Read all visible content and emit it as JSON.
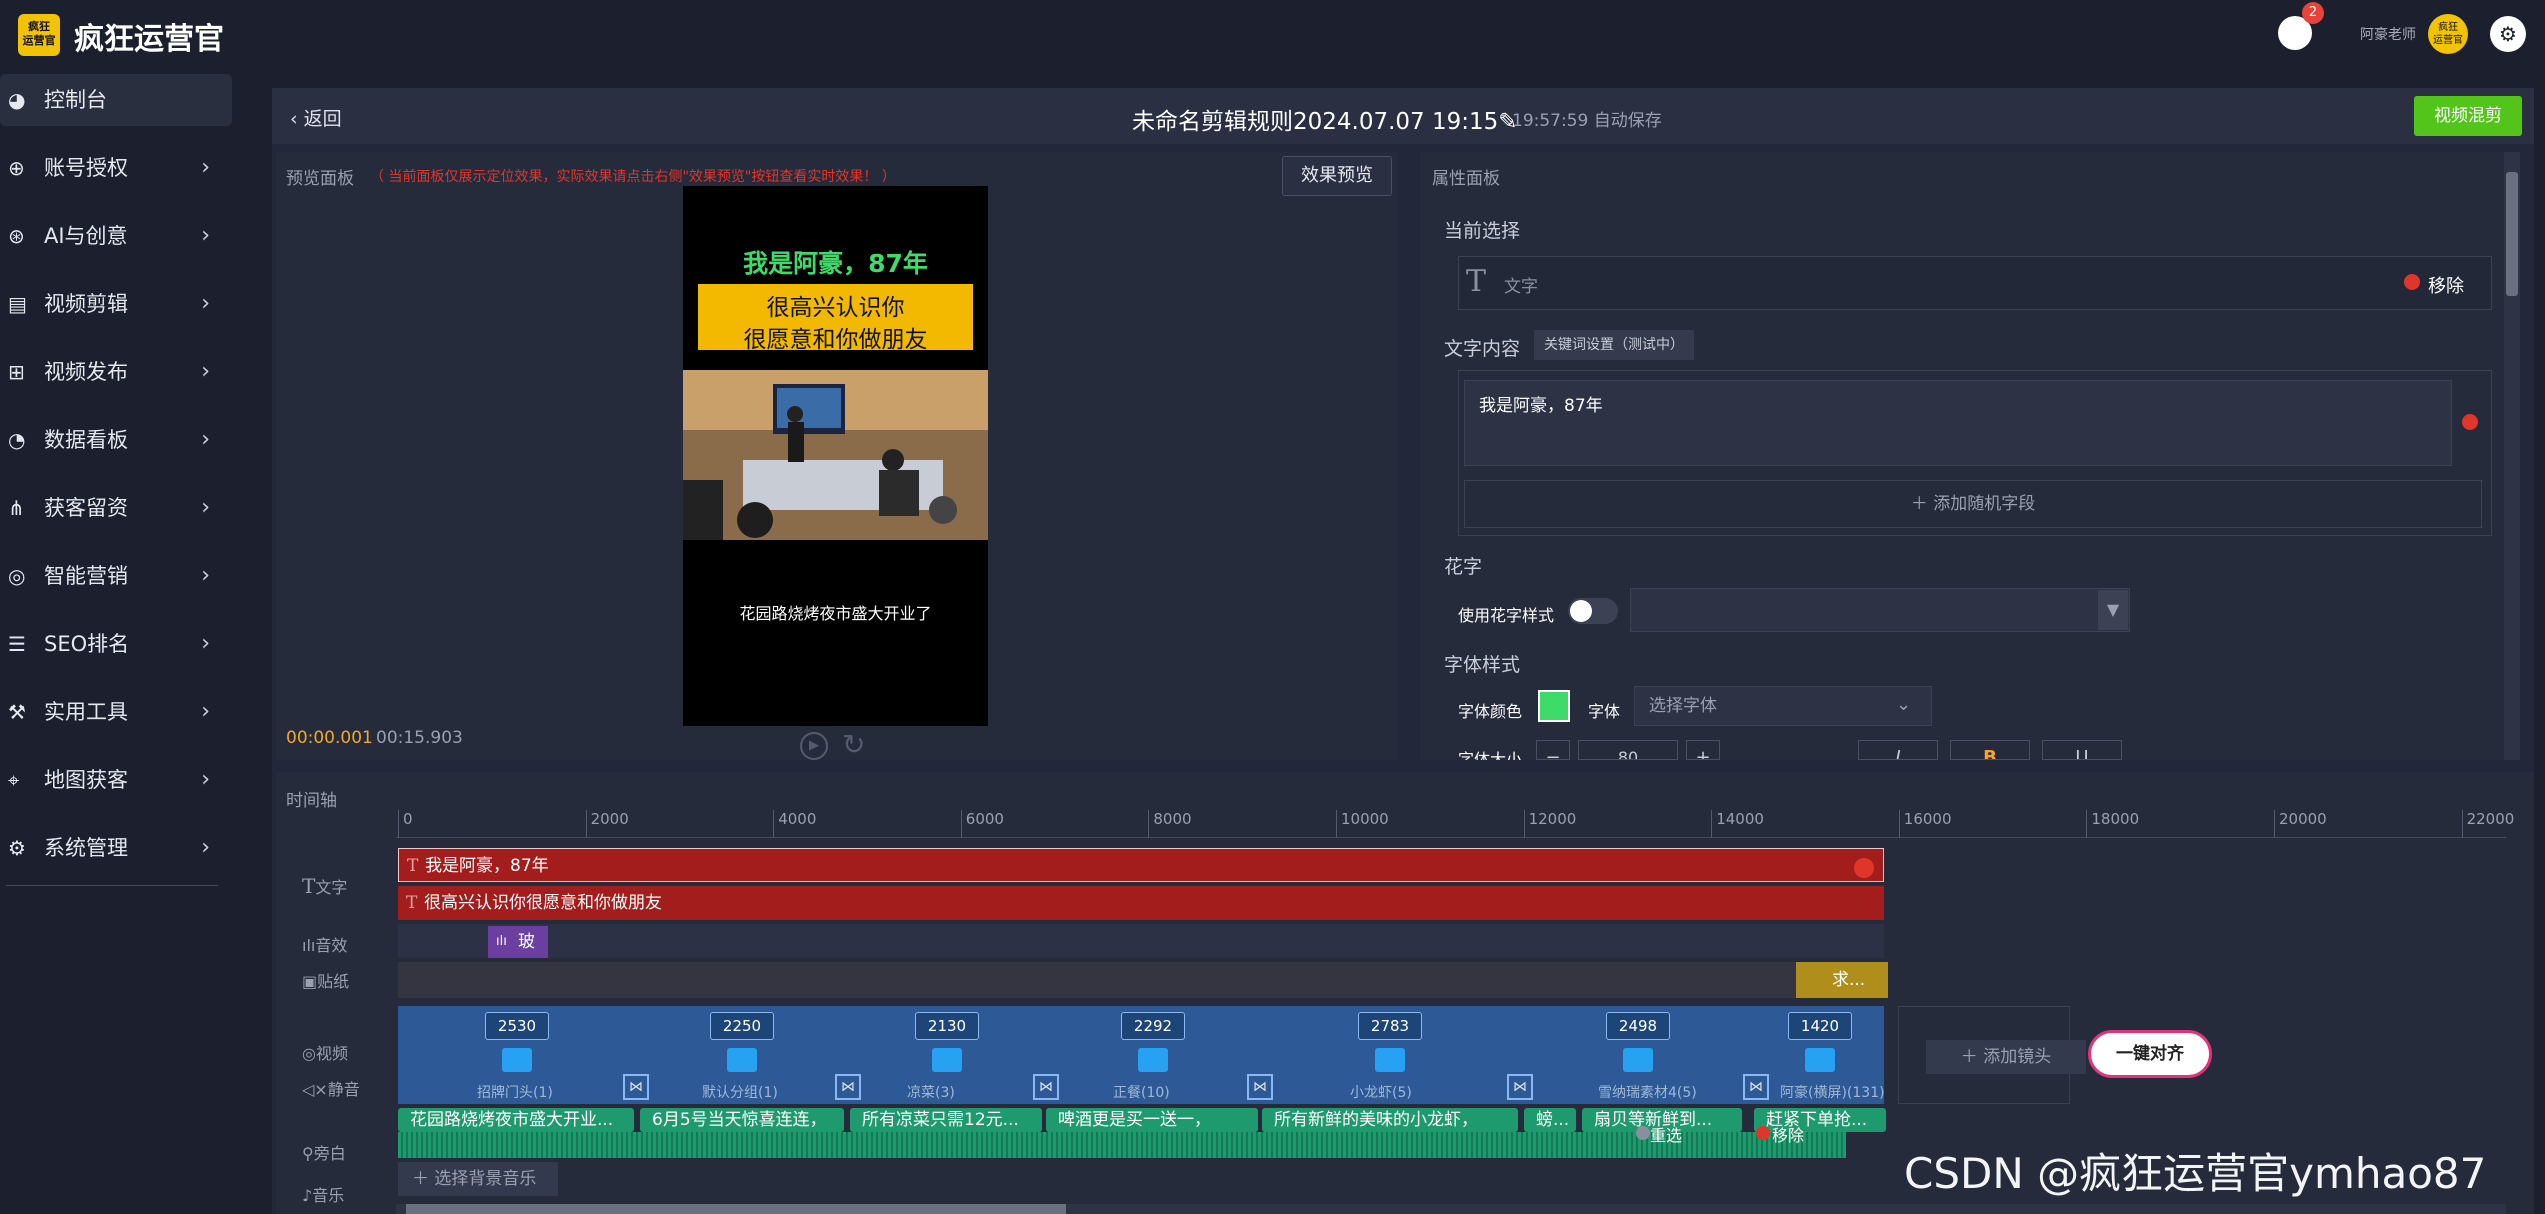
{
  "app": {
    "logo_text": "疯狂\n运营官",
    "brand": "疯狂运营官",
    "notifications": "2",
    "user": "阿豪老师",
    "avatar_text": "疯狂\n运营官"
  },
  "sidebar": {
    "items": [
      {
        "label": "控制台",
        "icon": "dashboard-icon",
        "active": true
      },
      {
        "label": "账号授权",
        "icon": "crosshair-icon"
      },
      {
        "label": "AI与创意",
        "icon": "globe-icon"
      },
      {
        "label": "视频剪辑",
        "icon": "film-icon"
      },
      {
        "label": "视频发布",
        "icon": "grid-icon"
      },
      {
        "label": "数据看板",
        "icon": "pie-icon"
      },
      {
        "label": "获客留资",
        "icon": "org-icon"
      },
      {
        "label": "智能营销",
        "icon": "target-icon"
      },
      {
        "label": "SEO排名",
        "icon": "list-icon"
      },
      {
        "label": "实用工具",
        "icon": "tools-icon"
      },
      {
        "label": "地图获客",
        "icon": "map-icon"
      },
      {
        "label": "系统管理",
        "icon": "gear-icon"
      }
    ]
  },
  "header": {
    "back": "返回",
    "title": "未命名剪辑规则2024.07.07 19:15",
    "autosave": "19:57:59 自动保存",
    "primary_button": "视频混剪"
  },
  "preview": {
    "label": "预览面板",
    "note": "（ 当前面板仅展示定位效果，实际效果请点击右侧\"效果预览\"按钮查看实时效果！ ）",
    "effect_button": "效果预览",
    "line1": "我是阿豪，87年",
    "line2": "很高兴认识你",
    "line3": "很愿意和你做朋友",
    "caption": "花园路烧烤夜市盛大开业了",
    "current_time": "00:00.001",
    "total_time": "00:15.903"
  },
  "properties": {
    "title": "属性面板",
    "current_selection_label": "当前选择",
    "selection_type": "文字",
    "remove": "移除",
    "text_content_label": "文字内容",
    "keyword_tag": "关键词设置（测试中）",
    "text_value": "我是阿豪，87年",
    "add_random_field": "添加随机字段",
    "flower_label": "花字",
    "use_flower_style": "使用花字样式",
    "font_style_label": "字体样式",
    "font_color_label": "字体颜色",
    "font_label": "字体",
    "font_placeholder": "选择字体",
    "font_size_label": "字体大小",
    "font_size": "80",
    "italic": "I",
    "bold": "B",
    "underline": "U"
  },
  "timeline": {
    "label": "时间轴",
    "ticks": [
      "0",
      "2000",
      "4000",
      "6000",
      "8000",
      "10000",
      "12000",
      "14000",
      "16000",
      "18000",
      "20000",
      "22000"
    ],
    "track_names": {
      "text": "文字",
      "audio": "音效",
      "sticker": "贴纸",
      "video": "视频",
      "mute": "静音",
      "narration": "旁白",
      "music": "音乐"
    },
    "text_bars": [
      "我是阿豪，87年",
      "很高兴认识你很愿意和你做朋友"
    ],
    "audio_clip": "玻璃",
    "sticker_clip": "求...",
    "video_segments": [
      {
        "count": "2530",
        "name": "招牌门头(1)"
      },
      {
        "count": "2250",
        "name": "默认分组(1)"
      },
      {
        "count": "2130",
        "name": "凉菜(3)"
      },
      {
        "count": "2292",
        "name": "正餐(10)"
      },
      {
        "count": "2783",
        "name": "小龙虾(5)"
      },
      {
        "count": "2498",
        "name": "雪纳瑞素材4(5)"
      },
      {
        "count": "1420",
        "name": "阿豪(横屏)(131)"
      }
    ],
    "add_shot": "添加镜头",
    "align_button": "一键对齐",
    "subtitles": [
      "花园路烧烤夜市盛大开业...",
      "6月5号当天惊喜连连，",
      "所有凉菜只需12元...",
      "啤酒更是买一送一，",
      "所有新鲜的美味的小龙虾，",
      "螃...",
      "扇贝等新鲜到...",
      "赶紧下单抢..."
    ],
    "redo": "重选",
    "remove": "移除",
    "bgm_button": "选择背景音乐"
  },
  "watermark": "CSDN @疯狂运营官ymhao87",
  "colors": {
    "accent": "#f5a623",
    "primary": "#52c41a",
    "danger": "#e0352b",
    "text_bar": "#a31d1d",
    "video_track": "#2d5a96",
    "subtitle_track": "#1f9a6e"
  }
}
